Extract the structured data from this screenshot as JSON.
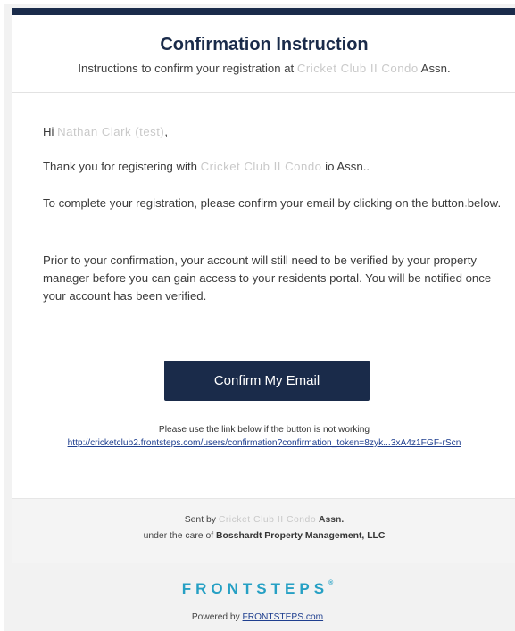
{
  "header": {
    "title": "Confirmation Instruction",
    "subtitle_prefix": "Instructions to confirm your registration at",
    "subtitle_assn_blurred": "Cricket Club II Condo",
    "subtitle_suffix": "Assn."
  },
  "body": {
    "greeting_prefix": "Hi",
    "greeting_name_blurred": "Nathan Clark (test)",
    "greeting_suffix": ",",
    "thanks_prefix": "Thank you for registering with",
    "thanks_assn_blurred": "Cricket Club II Condo",
    "thanks_suffix": "io Assn..",
    "instruction": "To complete your registration, please confirm your email by clicking on the button below.",
    "verification_note": "Prior to your confirmation, your account will still need to be verified by your property manager before you can gain access to your residents portal. You will be notified once your account has been verified."
  },
  "cta": {
    "label": "Confirm My Email"
  },
  "fallback": {
    "note": "Please use the link below if the button is not working",
    "link": "http://cricketclub2.frontsteps.com/users/confirmation?confirmation_token=8zyk...3xA4z1FGF-rScn"
  },
  "footer": {
    "sent_by_prefix": "Sent by",
    "sent_by_assn_blurred": "Cricket Club II Condo",
    "sent_by_suffix": "Assn.",
    "care_of_prefix": "under the care of",
    "care_of_company": "Bosshardt Property Management, LLC"
  },
  "brand": {
    "name": "FRONTSTEPS",
    "mark": "®",
    "powered_prefix": "Powered by",
    "powered_link": "FRONTSTEPS.com"
  },
  "colors": {
    "navy": "#1a2b4a",
    "brand_teal": "#26a0c4",
    "link_blue": "#1f3f8f"
  }
}
